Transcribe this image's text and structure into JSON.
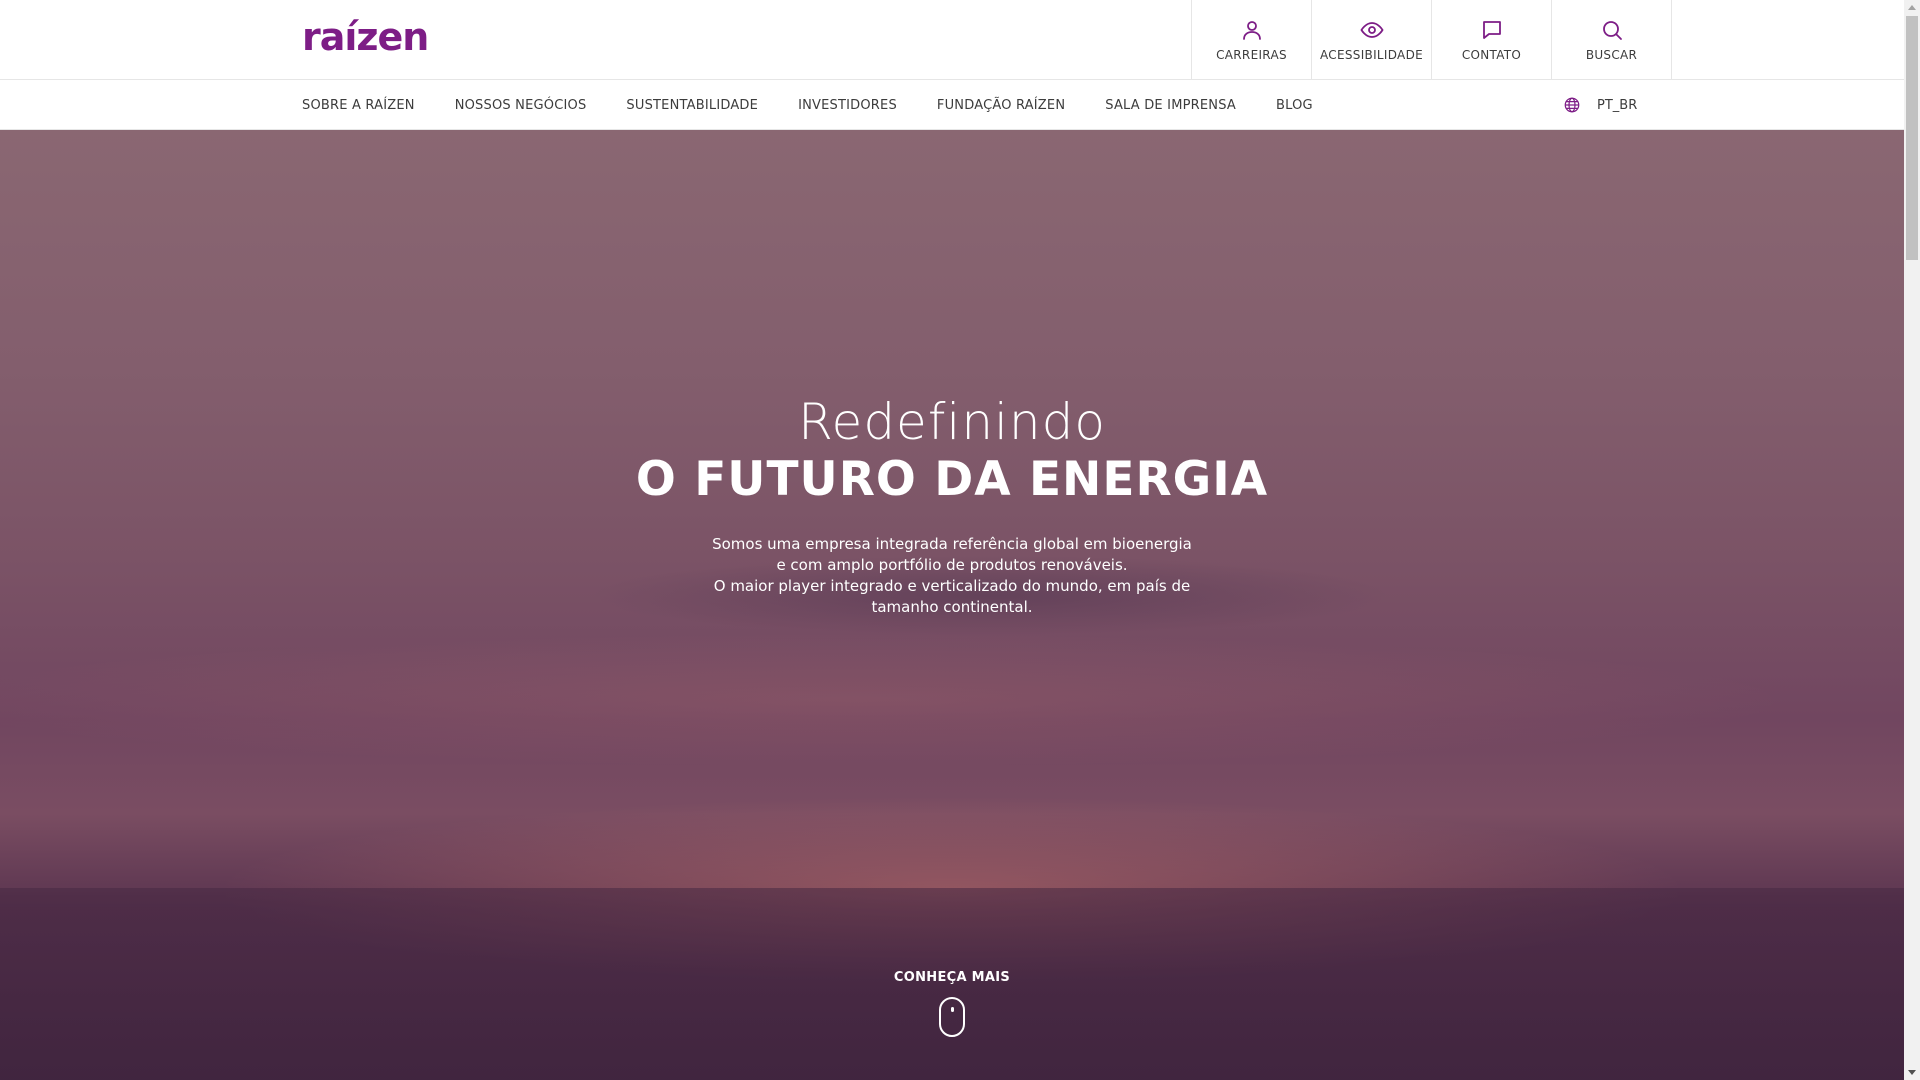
{
  "brand": {
    "logo_text": "raízen",
    "logo_color": "#7d1d86"
  },
  "utility_nav": [
    {
      "label": "CARREIRAS",
      "icon": "person-icon"
    },
    {
      "label": "ACESSIBILIDADE",
      "icon": "eye-icon"
    },
    {
      "label": "CONTATO",
      "icon": "chat-bubble-icon"
    },
    {
      "label": "BUSCAR",
      "icon": "search-icon"
    }
  ],
  "main_nav": [
    "SOBRE A RAÍZEN",
    "NOSSOS NEGÓCIOS",
    "SUSTENTABILIDADE",
    "INVESTIDORES",
    "FUNDAÇÃO RAÍZEN",
    "SALA DE IMPRENSA",
    "BLOG"
  ],
  "language": {
    "label": "PT_BR",
    "icon": "globe-icon"
  },
  "hero": {
    "title_light": "Redefinindo",
    "title_bold": "O FUTURO DA ENERGIA",
    "description_line1": "Somos uma empresa integrada referência global em bioenergia e com amplo portfólio de produtos renováveis.",
    "description_line2": "O maior player integrado e verticalizado do mundo, em país de tamanho continental.",
    "cta": "CONHEÇA MAIS",
    "cta_icon": "mouse-scroll-icon"
  }
}
